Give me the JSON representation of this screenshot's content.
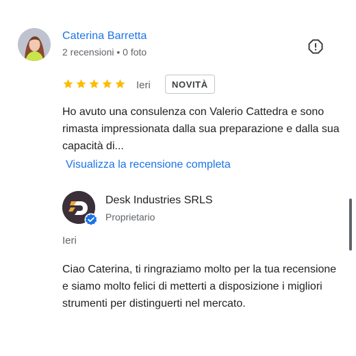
{
  "review": {
    "reviewer_name": "Caterina Barretta",
    "reviewer_meta": "2 recensioni • 0 foto",
    "rating": 5,
    "max_rating": 5,
    "date": "Ieri",
    "badge": "NOVITÀ",
    "text": "Ho avuto una consulenza con Valerio Cattedra e sono rimasta impressionata dalla sua preparazione e dalla sua capacità di...",
    "more_link": "Visualizza la recensione completa"
  },
  "owner_reply": {
    "name": "Desk Industries SRLS",
    "role": "Proprietario",
    "date": "Ieri",
    "text": "Ciao Caterina, ti ringraziamo molto per la tua recensione e siamo molto felici di metterti a disposizione i migliori strumenti per distinguerti nel mercato."
  },
  "icons": {
    "flag": "report-icon",
    "star": "star-icon",
    "verified": "verified-check-icon"
  },
  "colors": {
    "link": "#1a73e8",
    "star": "#fbbc04",
    "verified": "#1a73e8"
  }
}
